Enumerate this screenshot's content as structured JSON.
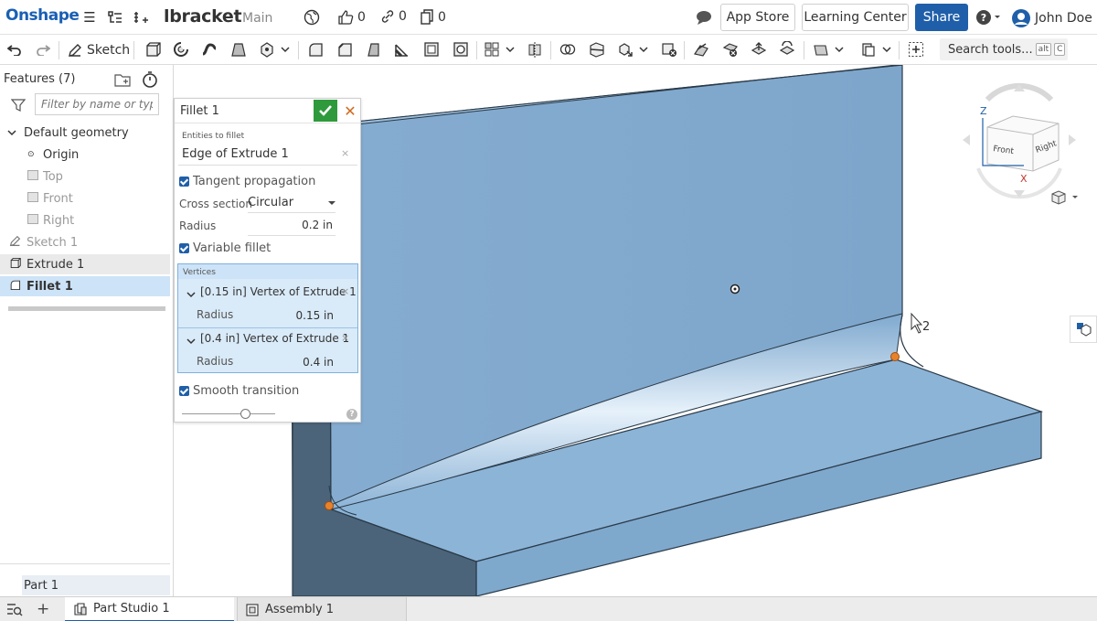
{
  "app": {
    "logo": "Onshape",
    "doc_name": "lbracket",
    "branch": "Main"
  },
  "header": {
    "likes": "0",
    "links": "0",
    "copies": "0",
    "app_store": "App Store",
    "learning_center": "Learning Center",
    "share": "Share",
    "user_name": "John Doe"
  },
  "toolbar": {
    "sketch_label": "Sketch",
    "search_label": "Search tools...",
    "search_key1": "alt",
    "search_key2": "C"
  },
  "features": {
    "header": "Features (7)",
    "filter_placeholder": "Filter by name or type",
    "items": [
      {
        "label": "Default geometry"
      },
      {
        "label": "Origin"
      },
      {
        "label": "Top"
      },
      {
        "label": "Front"
      },
      {
        "label": "Right"
      },
      {
        "label": "Sketch 1"
      },
      {
        "label": "Extrude 1"
      },
      {
        "label": "Fillet 1"
      }
    ],
    "parts_label": "Part 1"
  },
  "dialog": {
    "title": "Fillet 1",
    "entities_label": "Entities to fillet",
    "entity": "Edge of Extrude 1",
    "tangent": "Tangent propagation",
    "cross_section_label": "Cross section",
    "cross_section_value": "Circular",
    "radius_label": "Radius",
    "radius_value": "0.2 in",
    "variable": "Variable fillet",
    "vertices_label": "Vertices",
    "vertices": [
      {
        "title": "[0.15 in] Vertex of Extrude 1",
        "radius_label": "Radius",
        "radius_value": "0.15 in"
      },
      {
        "title": "[0.4 in] Vertex of Extrude 1",
        "radius_label": "Radius",
        "radius_value": "0.4 in"
      }
    ],
    "smooth": "Smooth transition"
  },
  "viewcube": {
    "z": "Z",
    "x": "X",
    "front": "Front",
    "right": "Right"
  },
  "cursor_count": "2",
  "tabs": [
    {
      "label": "Part Studio 1"
    },
    {
      "label": "Assembly 1"
    }
  ],
  "colors": {
    "brand": "#1a5fb4",
    "accent": "#1f5fa9",
    "part_face": "#8fb6d8",
    "part_dark": "#4b6479",
    "selection": "#cde3f7",
    "ok": "#2f9a3c"
  }
}
